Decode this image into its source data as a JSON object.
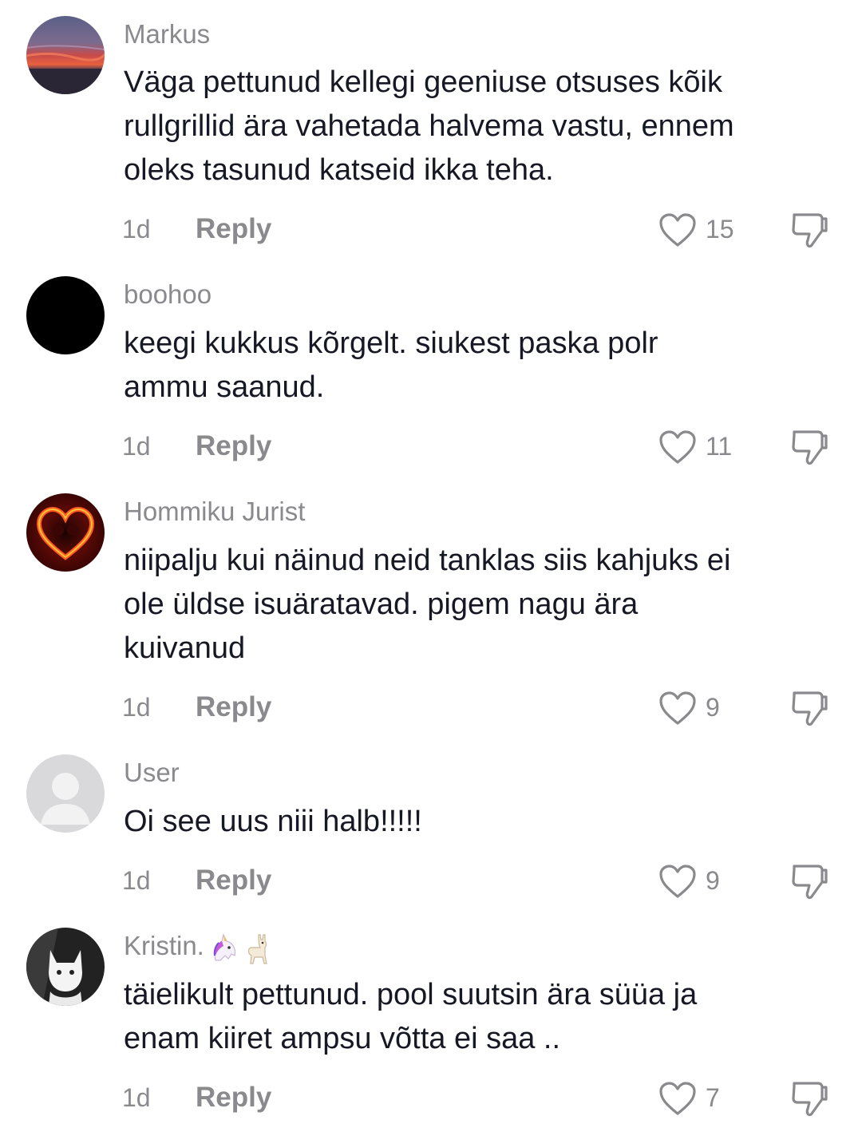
{
  "comments": [
    {
      "username": "Markus",
      "text": "Väga pettunud kellegi geeniuse otsuses kõik\nrullgrillid ära vahetada halvema vastu, ennem\noleks tasunud katseid ikka teha.",
      "time": "1d",
      "reply_label": "Reply",
      "likes": "15"
    },
    {
      "username": "boohoo",
      "text": "keegi kukkus kõrgelt. siukest paska polr\nammu saanud.",
      "time": "1d",
      "reply_label": "Reply",
      "likes": "11"
    },
    {
      "username": "Hommiku Jurist",
      "text": "niipalju kui näinud neid tanklas siis kahjuks ei\nole üldse isuäratavad. pigem nagu ära\nkuivanud",
      "time": "1d",
      "reply_label": "Reply",
      "likes": "9"
    },
    {
      "username": "User",
      "text": "Oi see uus niii halb!!!!!",
      "time": "1d",
      "reply_label": "Reply",
      "likes": "9"
    },
    {
      "username": "Kristin.",
      "username_emojis": [
        "unicorn-emoji",
        "llama-emoji"
      ],
      "text": "täielikult pettunud. pool suutsin ära süüa ja\nenam kiiret ampsu võtta ei saa ..",
      "time": "1d",
      "reply_label": "Reply",
      "likes": "7"
    }
  ],
  "icons": {
    "like": "heart-outline-icon",
    "dislike": "thumbs-down-icon"
  },
  "colors": {
    "text": "#161823",
    "secondary": "#8a8a8e",
    "background": "#ffffff"
  }
}
